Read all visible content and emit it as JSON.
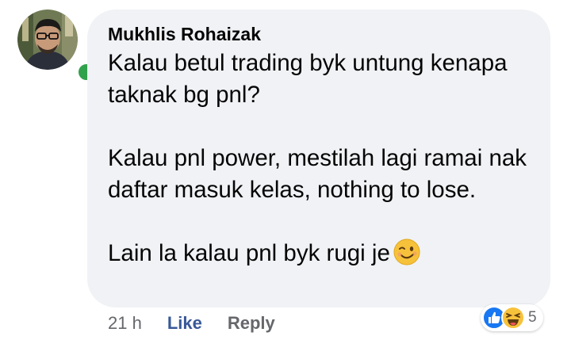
{
  "comment": {
    "author": "Mukhlis Rohaizak",
    "paragraphs": [
      "Kalau betul trading byk untung kenapa taknak bg pnl?",
      "Kalau pnl power, mestilah lagi ramai nak daftar masuk kelas, nothing to lose.",
      "Lain la kalau pnl byk rugi je"
    ],
    "trailing_emoji": "winking-face",
    "timestamp": "21 h",
    "like_label": "Like",
    "reply_label": "Reply",
    "reactions": {
      "types": [
        "like",
        "haha"
      ],
      "count": "5"
    }
  },
  "colors": {
    "bubble": "#f0f2f5",
    "text": "#050505",
    "meta": "#65676b",
    "like_link": "#385898",
    "online": "#31a24c"
  }
}
